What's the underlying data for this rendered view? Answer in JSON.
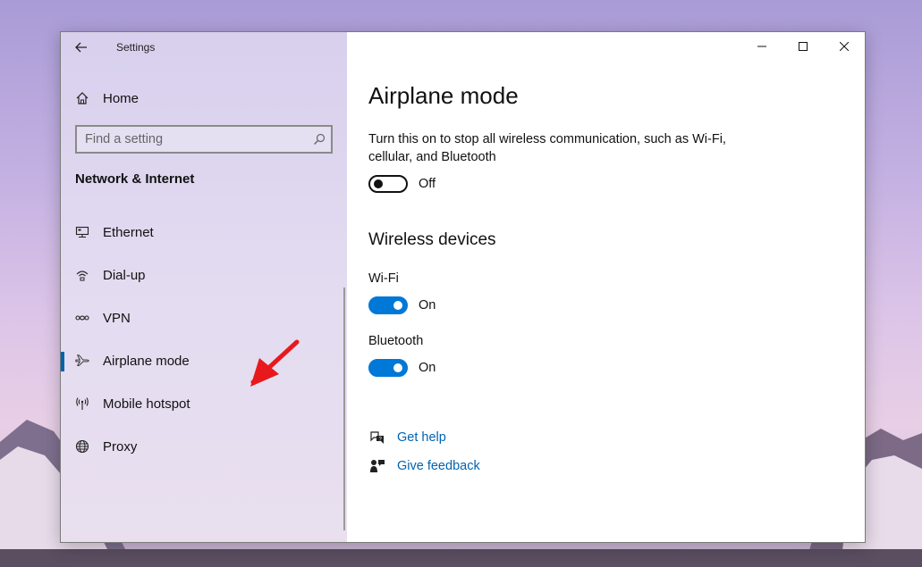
{
  "window": {
    "app_title": "Settings",
    "back_icon": "back-arrow-icon"
  },
  "sidebar": {
    "home_label": "Home",
    "search_placeholder": "Find a setting",
    "section_title": "Network & Internet",
    "items": [
      {
        "label": "Ethernet",
        "icon": "ethernet-icon",
        "active": false
      },
      {
        "label": "Dial-up",
        "icon": "dial-up-icon",
        "active": false
      },
      {
        "label": "VPN",
        "icon": "vpn-icon",
        "active": false
      },
      {
        "label": "Airplane mode",
        "icon": "airplane-icon",
        "active": true
      },
      {
        "label": "Mobile hotspot",
        "icon": "hotspot-icon",
        "active": false
      },
      {
        "label": "Proxy",
        "icon": "globe-icon",
        "active": false
      }
    ]
  },
  "main": {
    "title": "Airplane mode",
    "description": "Turn this on to stop all wireless communication, such as Wi-Fi, cellular, and Bluetooth",
    "airplane_toggle": {
      "state": "Off"
    },
    "wireless_title": "Wireless devices",
    "wifi": {
      "label": "Wi-Fi",
      "state": "On"
    },
    "bluetooth": {
      "label": "Bluetooth",
      "state": "On"
    },
    "links": {
      "help": "Get help",
      "feedback": "Give feedback"
    }
  },
  "colors": {
    "accent": "#0078d7",
    "link": "#0063b1",
    "annotation_arrow": "#e8191c"
  }
}
